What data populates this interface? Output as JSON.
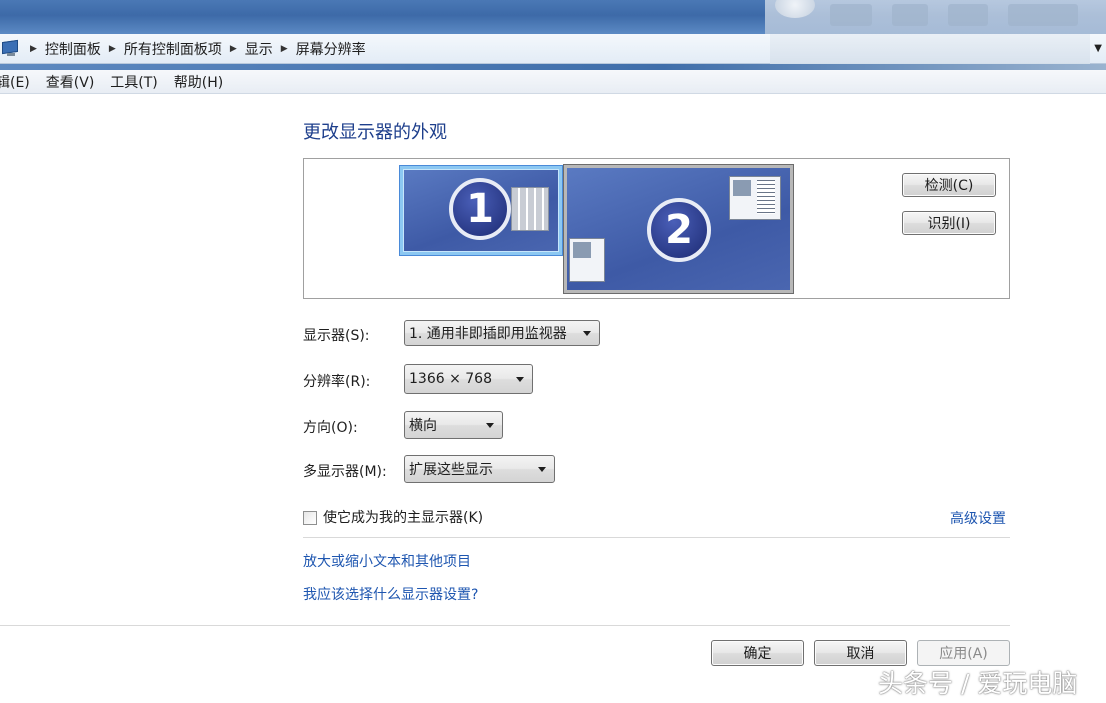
{
  "address_bar": {
    "crumbs": [
      "控制面板",
      "所有控制面板项",
      "显示",
      "屏幕分辨率"
    ]
  },
  "menu_bar": {
    "items": [
      "辑(E)",
      "查看(V)",
      "工具(T)",
      "帮助(H)"
    ]
  },
  "heading": "更改显示器的外观",
  "monitors": {
    "monitor_1_number": "1",
    "monitor_2_number": "2",
    "detect_button": "检测(C)",
    "identify_button": "识别(I)"
  },
  "settings": {
    "display": {
      "label": "显示器(S):",
      "value": "1. 通用非即插即用监视器"
    },
    "resolution": {
      "label": "分辨率(R):",
      "value": "1366 × 768"
    },
    "orientation": {
      "label": "方向(O):",
      "value": "横向"
    },
    "multiple_displays": {
      "label": "多显示器(M):",
      "value": "扩展这些显示"
    }
  },
  "primary_display_checkbox": {
    "label": "使它成为我的主显示器(K)",
    "checked": false
  },
  "advanced_link": "高级设置",
  "links": {
    "text_size": "放大或缩小文本和其他项目",
    "which_settings": "我应该选择什么显示器设置?"
  },
  "footer": {
    "ok": "确定",
    "cancel": "取消",
    "apply": "应用(A)"
  },
  "watermark": "头条号 / 爱玩电脑",
  "colors": {
    "heading": "#1e3f8c",
    "link": "#1e56b0",
    "selected_monitor_border": "#8cc8f2"
  }
}
